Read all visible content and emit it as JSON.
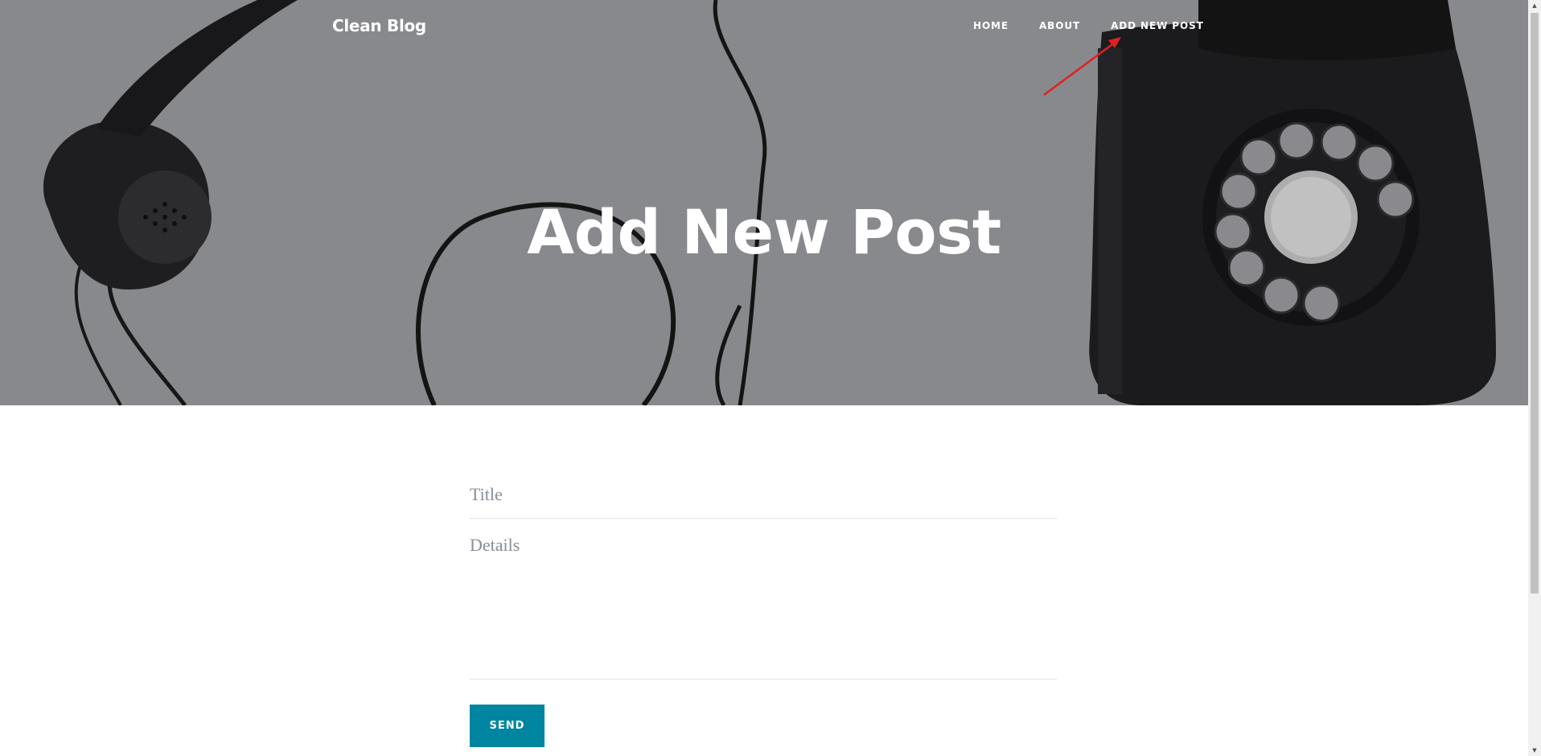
{
  "navbar": {
    "brand": "Clean Blog",
    "links": [
      {
        "label": "HOME"
      },
      {
        "label": "ABOUT"
      },
      {
        "label": "ADD NEW POST"
      }
    ]
  },
  "hero": {
    "title": "Add New Post",
    "background_image": "vintage-rotary-telephone-photo"
  },
  "annotation": {
    "color": "#e02020",
    "points_to": "ADD NEW POST"
  },
  "form": {
    "title_placeholder": "Title",
    "title_value": "",
    "details_placeholder": "Details",
    "details_value": "",
    "send_label": "SEND"
  },
  "colors": {
    "accent": "#0085a1",
    "hero_gray": "#8c8d90",
    "placeholder": "#868e96"
  }
}
